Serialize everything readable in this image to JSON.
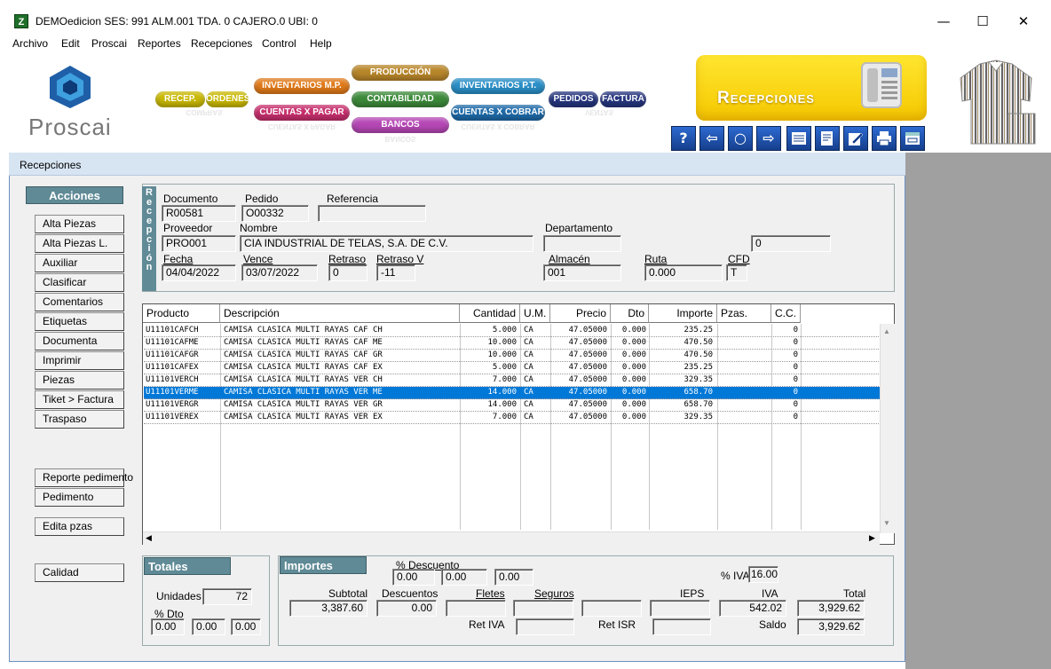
{
  "window": {
    "title": "DEMOedicion  SES: 991  ALM.001  TDA. 0  CAJERO.0  UBI: 0",
    "app_icon": "Z"
  },
  "menu": [
    "Archivo",
    "Edit",
    "Proscai",
    "Reportes",
    "Recepciones",
    "Control",
    "Help"
  ],
  "logo": {
    "text": "Proscai"
  },
  "modules": {
    "recep": "RECEP.",
    "ordenes": "ORDENES",
    "inv_mp": "INVENTARIOS M.P.",
    "cxp": "CUENTAS X PAGAR",
    "produccion": "PRODUCCIÓN",
    "contabilidad": "CONTABILIDAD",
    "bancos": "BANCOS",
    "inv_pt": "INVENTARIOS P.T.",
    "cxc": "CUENTAS X COBRAR",
    "pedidos": "PEDIDOS",
    "factura": "FACTURA",
    "refl_compras": "COMPRAS",
    "refl_cxp": "CUENTAS X PAGAR",
    "refl_bancos": "BANCOS",
    "refl_cxc": "CUENTAS X COBRAR",
    "refl_ventas": "VENTAS"
  },
  "banner_title": "Recepciones",
  "toolbar": {
    "help": "?",
    "back": "⇦",
    "search": "○",
    "forward": "⇨"
  },
  "form_title": "Recepciones",
  "acciones": {
    "title": "Acciones",
    "buttons": [
      "Alta Piezas",
      "Alta Piezas L.",
      "Auxiliar",
      "Clasificar",
      "Comentarios",
      "Etiquetas",
      "Documenta",
      "Imprimir",
      "Piezas",
      "Tiket > Factura",
      "Traspaso"
    ],
    "lower": [
      "Reporte pedimento",
      "Pedimento",
      "Edita pzas",
      "Calidad"
    ]
  },
  "recepcion_tab": "Recepción",
  "header": {
    "documento_lbl": "Documento",
    "documento": "R00581",
    "pedido_lbl": "Pedido",
    "pedido": "O00332",
    "referencia_lbl": "Referencia",
    "referencia": "",
    "proveedor_lbl": "Proveedor",
    "proveedor": "PRO001",
    "nombre_lbl": "Nombre",
    "nombre": "CIA INDUSTRIAL DE TELAS, S.A. DE C.V.",
    "departamento_lbl": "Departamento",
    "departamento": "",
    "dep_num": "0",
    "fecha_lbl": "Fecha",
    "fecha": "04/04/2022",
    "vence_lbl": "Vence",
    "vence": "03/07/2022",
    "retraso_lbl": "Retraso",
    "retraso": "0",
    "retrasov_lbl": "Retraso V",
    "retrasov": "-11",
    "almacen_lbl": "Almacén",
    "almacen": "001",
    "ruta_lbl": "Ruta",
    "ruta": "0.000",
    "cfd_lbl": "CFD",
    "cfd": "T"
  },
  "table": {
    "columns": [
      "Producto",
      "Descripción",
      "Cantidad",
      "U.M.",
      "Precio",
      "Dto",
      "Importe",
      "Pzas.",
      "C.C."
    ],
    "rows": [
      [
        "U11101CAFCH",
        "CAMISA CLASICA MULTI RAYAS CAF CH",
        "5.000",
        "CA",
        "47.05000",
        "0.000",
        "235.25",
        "",
        "0"
      ],
      [
        "U11101CAFME",
        "CAMISA CLASICA MULTI RAYAS CAF ME",
        "10.000",
        "CA",
        "47.05000",
        "0.000",
        "470.50",
        "",
        "0"
      ],
      [
        "U11101CAFGR",
        "CAMISA CLASICA MULTI RAYAS CAF GR",
        "10.000",
        "CA",
        "47.05000",
        "0.000",
        "470.50",
        "",
        "0"
      ],
      [
        "U11101CAFEX",
        "CAMISA CLASICA MULTI RAYAS CAF EX",
        "5.000",
        "CA",
        "47.05000",
        "0.000",
        "235.25",
        "",
        "0"
      ],
      [
        "U11101VERCH",
        "CAMISA CLASICA MULTI RAYAS VER CH",
        "7.000",
        "CA",
        "47.05000",
        "0.000",
        "329.35",
        "",
        "0"
      ],
      [
        "U11101VERME",
        "CAMISA CLASICA MULTI RAYAS VER ME",
        "14.000",
        "CA",
        "47.05000",
        "0.000",
        "658.70",
        "",
        "0"
      ],
      [
        "U11101VERGR",
        "CAMISA CLASICA MULTI RAYAS VER GR",
        "14.000",
        "CA",
        "47.05000",
        "0.000",
        "658.70",
        "",
        "0"
      ],
      [
        "U11101VEREX",
        "CAMISA CLASICA MULTI RAYAS VER EX",
        "7.000",
        "CA",
        "47.05000",
        "0.000",
        "329.35",
        "",
        "0"
      ]
    ],
    "selected_row": 5
  },
  "totales": {
    "title": "Totales",
    "unidades_lbl": "Unidades",
    "unidades": "72",
    "dto_lbl": "% Dto",
    "dto1": "0.00",
    "dto2": "0.00",
    "dto3": "0.00"
  },
  "importes": {
    "title": "Importes",
    "pdesc_lbl": "% Descuento",
    "pdesc1": "0.00",
    "pdesc2": "0.00",
    "pdesc3": "0.00",
    "piva_lbl": "% IVA",
    "piva": "16.00",
    "subtotal_lbl": "Subtotal",
    "subtotal": "3,387.60",
    "descuentos_lbl": "Descuentos",
    "descuentos": "0.00",
    "fletes_lbl": "Fletes",
    "fletes": "",
    "seguros_lbl": "Seguros",
    "seguros": "",
    "ieps_lbl": "IEPS",
    "ieps": "",
    "iva_lbl": "IVA",
    "iva": "542.02",
    "total_lbl": "Total",
    "total": "3,929.62",
    "retiva_lbl": "Ret IVA",
    "retiva": "",
    "retisr_lbl": "Ret ISR",
    "retisr": "",
    "saldo_lbl": "Saldo",
    "saldo": "3,929.62"
  },
  "colors": {
    "accent": "#5f8a96",
    "selection": "#0078d7",
    "banner_yellow": "#f5c800"
  }
}
